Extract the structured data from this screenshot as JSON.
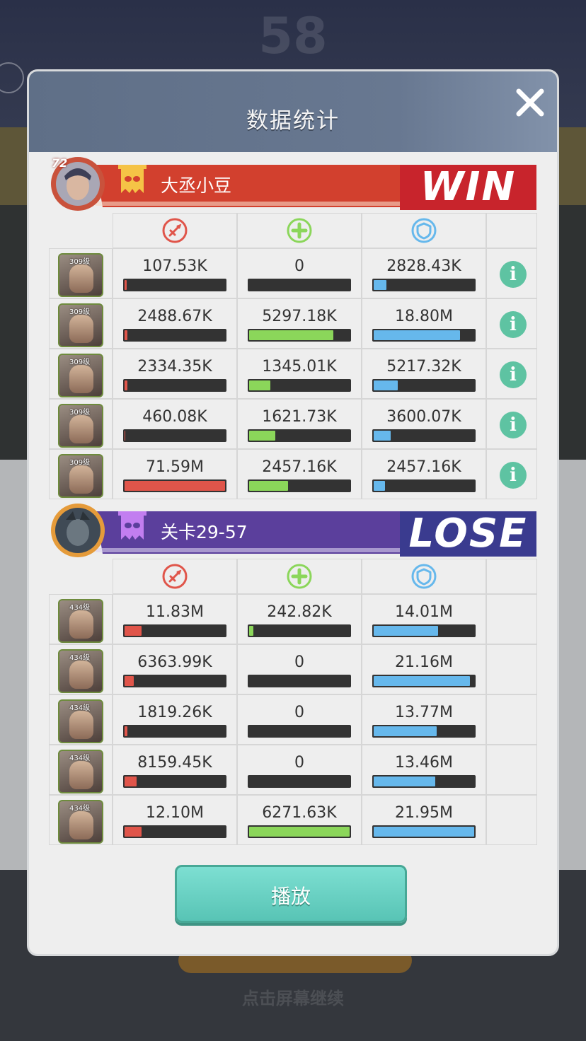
{
  "background": {
    "score_text": "58",
    "hint_text": "点击屏幕继续"
  },
  "modal": {
    "title": "数据统计",
    "play_label": "播放"
  },
  "team1": {
    "avatar_level": "72",
    "name": "大丞小豆",
    "result": "WIN",
    "bar_color": "#d2402e",
    "result_color": "#c8242c",
    "heroes": [
      {
        "level": "309级",
        "damage": "107.53K",
        "damage_pct": 0.02,
        "heal": "0",
        "heal_pct": 0,
        "tank": "2828.43K",
        "tank_pct": 0.13
      },
      {
        "level": "309级",
        "damage": "2488.67K",
        "damage_pct": 0.03,
        "heal": "5297.18K",
        "heal_pct": 0.84,
        "tank": "18.80M",
        "tank_pct": 0.86
      },
      {
        "level": "309级",
        "damage": "2334.35K",
        "damage_pct": 0.03,
        "heal": "1345.01K",
        "heal_pct": 0.21,
        "tank": "5217.32K",
        "tank_pct": 0.24
      },
      {
        "level": "309级",
        "damage": "460.08K",
        "damage_pct": 0.01,
        "heal": "1621.73K",
        "heal_pct": 0.26,
        "tank": "3600.07K",
        "tank_pct": 0.17
      },
      {
        "level": "309级",
        "damage": "71.59M",
        "damage_pct": 1.0,
        "heal": "2457.16K",
        "heal_pct": 0.39,
        "tank": "2457.16K",
        "tank_pct": 0.11
      }
    ]
  },
  "team2": {
    "name": "关卡29-57",
    "result": "LOSE",
    "bar_color": "#5b3f9c",
    "result_color": "#3a3b8f",
    "heroes": [
      {
        "level": "434级",
        "damage": "11.83M",
        "damage_pct": 0.17,
        "heal": "242.82K",
        "heal_pct": 0.04,
        "tank": "14.01M",
        "tank_pct": 0.64
      },
      {
        "level": "434级",
        "damage": "6363.99K",
        "damage_pct": 0.09,
        "heal": "0",
        "heal_pct": 0,
        "tank": "21.16M",
        "tank_pct": 0.96
      },
      {
        "level": "434级",
        "damage": "1819.26K",
        "damage_pct": 0.03,
        "heal": "0",
        "heal_pct": 0,
        "tank": "13.77M",
        "tank_pct": 0.63
      },
      {
        "level": "434级",
        "damage": "8159.45K",
        "damage_pct": 0.12,
        "heal": "0",
        "heal_pct": 0,
        "tank": "13.46M",
        "tank_pct": 0.61
      },
      {
        "level": "434级",
        "damage": "12.10M",
        "damage_pct": 0.17,
        "heal": "6271.63K",
        "heal_pct": 1.0,
        "tank": "21.95M",
        "tank_pct": 1.0
      }
    ]
  },
  "colors": {
    "damage": "#e0554a",
    "heal": "#8bd65a",
    "tank": "#66b8ec",
    "info": "#5ec3a2"
  },
  "icons": {
    "damage": "sword-icon",
    "heal": "heal-cross-icon",
    "tank": "shield-icon",
    "info": "info-icon",
    "close": "close-icon",
    "banner": "mask-banner-icon"
  }
}
